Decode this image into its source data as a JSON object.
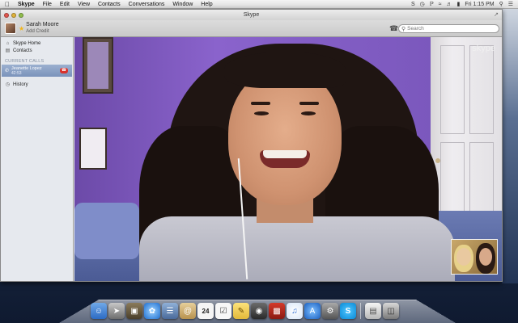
{
  "menubar": {
    "app": "Skype",
    "items": [
      "File",
      "Edit",
      "View",
      "Contacts",
      "Conversations",
      "Window",
      "Help"
    ],
    "clock": "Fri 1:15 PM"
  },
  "window": {
    "title": "Skype"
  },
  "profile": {
    "name": "Sarah Moore",
    "credit_link": "Add Credit"
  },
  "search": {
    "placeholder": "Search"
  },
  "sidebar": {
    "home": "Skype Home",
    "contacts": "Contacts",
    "section_current_calls": "CURRENT CALLS",
    "call": {
      "name": "Jeanette Lopez",
      "duration": "42:53"
    },
    "history": "History"
  },
  "video": {
    "watermark": "skype"
  },
  "dock": {
    "icons": [
      "finder-icon",
      "launchpad-icon",
      "image-capture-icon",
      "safari-icon",
      "preview-icon",
      "address-book-icon",
      "calendar-icon",
      "reminders-icon",
      "stickies-icon",
      "facetime-icon",
      "photo-booth-icon",
      "itunes-icon",
      "app-store-icon",
      "system-preferences-icon",
      "skype-icon",
      "documents-icon",
      "trash-icon"
    ],
    "calendar_day": "24"
  }
}
